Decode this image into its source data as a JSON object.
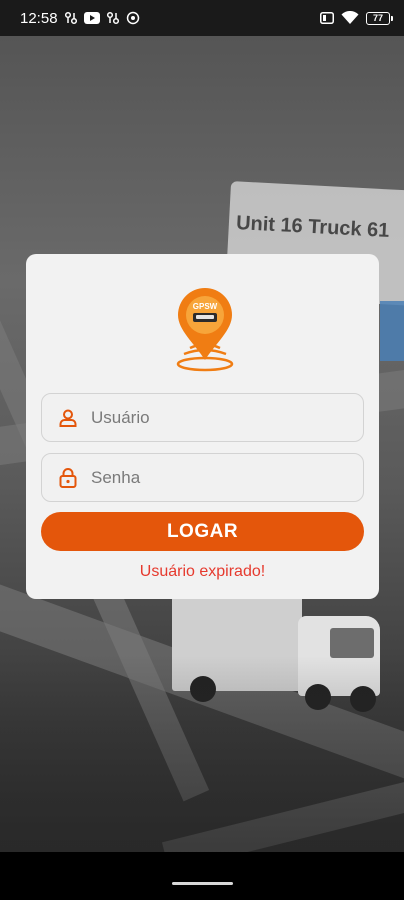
{
  "status_bar": {
    "time": "12:58",
    "battery": "77",
    "icons": [
      "jumper-icon",
      "youtube-icon",
      "jumper-icon",
      "record-icon",
      "sim-icon",
      "wifi-icon",
      "battery-icon"
    ]
  },
  "background": {
    "sign_text": "Unit 16 Truck 61"
  },
  "login": {
    "logo_text": "GPSW",
    "username_placeholder": "Usuário",
    "password_placeholder": "Senha",
    "login_button": "LOGAR",
    "error_message": "Usuário expirado!"
  },
  "colors": {
    "accent": "#e4560b",
    "error": "#e63a2e",
    "card_bg": "#f2f2f2"
  }
}
